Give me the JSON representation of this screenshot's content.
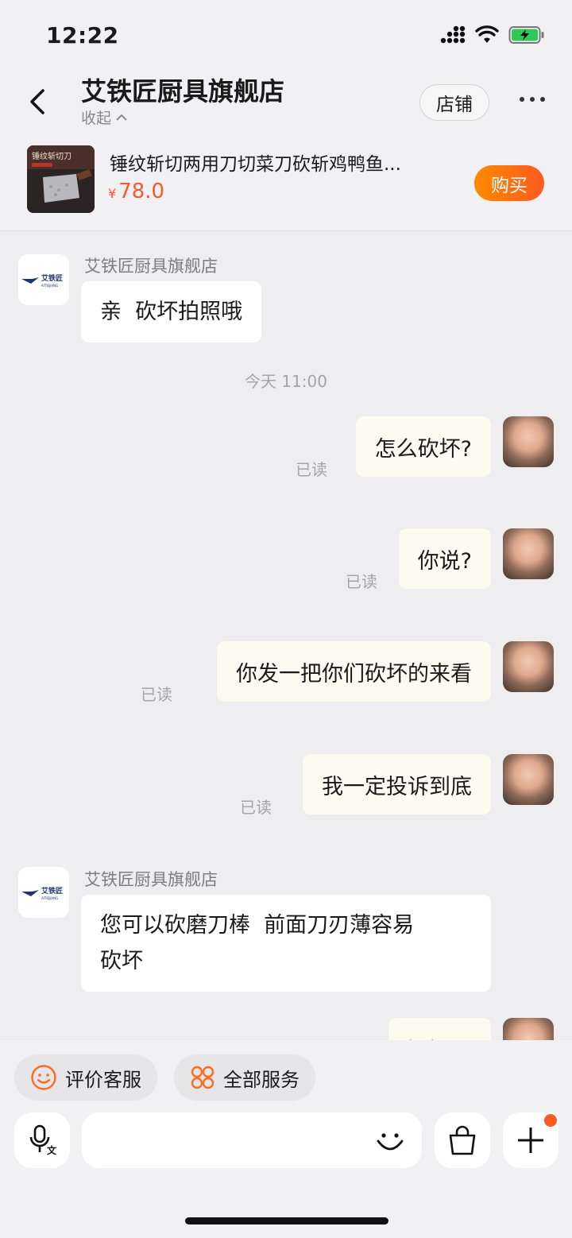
{
  "status_bar": {
    "time": "12:22"
  },
  "header": {
    "shop_name": "艾铁匠厨具旗舰店",
    "collapse_label": "收起",
    "store_button": "店铺"
  },
  "product": {
    "image_text": "锤纹斩切刀",
    "title": "锤纹斩切两用刀切菜刀砍斩鸡鸭鱼...",
    "currency": "¥",
    "price": "78.0",
    "buy_label": "购买"
  },
  "shop_logo": {
    "text": "艾铁匠",
    "sub": "AITIEJIANG"
  },
  "messages": [
    {
      "dir": "in",
      "sender": "艾铁匠厨具旗舰店",
      "text": "亲  砍坏拍照哦"
    },
    {
      "dir": "time",
      "text": "今天 11:00"
    },
    {
      "dir": "out",
      "text": "怎么砍坏?",
      "status": "已读"
    },
    {
      "dir": "out",
      "text": "你说?",
      "status": "已读"
    },
    {
      "dir": "out",
      "text": "你发一把你们砍坏的来看",
      "status": "已读"
    },
    {
      "dir": "out",
      "text": "我一定投诉到底",
      "status": "已读"
    },
    {
      "dir": "in",
      "sender": "艾铁匠厨具旗舰店",
      "text_line1": "您可以砍磨刀棒  前面刀刃薄容易",
      "text_line2": "砍坏"
    },
    {
      "dir": "out",
      "text": "没问题"
    }
  ],
  "quick_actions": [
    {
      "label": "评价客服",
      "icon": "smile-icon"
    },
    {
      "label": "全部服务",
      "icon": "grid-icon"
    }
  ],
  "input": {
    "placeholder": ""
  },
  "colors": {
    "accent": "#ff5a1f",
    "price": "#f2592d",
    "background": "#eeeef0"
  }
}
